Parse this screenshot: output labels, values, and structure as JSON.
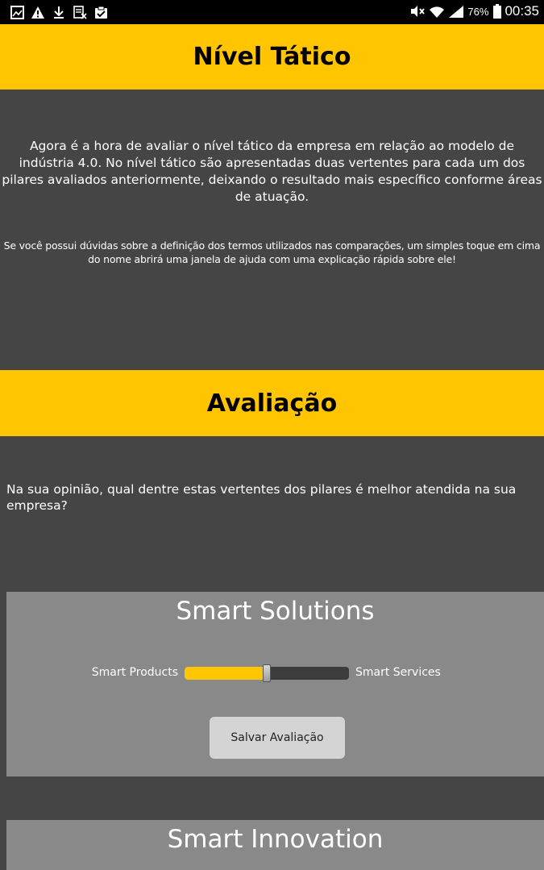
{
  "status_bar": {
    "left_icons": [
      "gallery-icon",
      "warning-icon",
      "download-icon",
      "screenshot-icon",
      "clipboard-check-icon"
    ],
    "battery_percent": "76%",
    "time": "00:35"
  },
  "header": {
    "title": "Nível Tático"
  },
  "intro": {
    "text": "Agora é a hora de avaliar o nível tático da empresa em relação ao modelo de indústria 4.0. No nível tático são apresentadas duas vertentes para cada um dos pilares avaliados anteriormente, deixando o resultado mais específico conforme áreas de atuação.",
    "help": "Se você possui dúvidas sobre a definição dos termos utilizados nas comparações, um simples toque em cima do nome abrirá uma janela de ajuda com uma explicação rápida sobre ele!"
  },
  "evaluation": {
    "title": "Avaliação",
    "question": "Na sua opinião, qual dentre estas vertentes dos pilares é melhor atendida na sua empresa?"
  },
  "cards": [
    {
      "title": "Smart Solutions",
      "left_label": "Smart Products",
      "right_label": "Smart Services",
      "slider_value": 0.5,
      "button_label": "Salvar Avaliação"
    },
    {
      "title": "Smart Innovation"
    }
  ],
  "colors": {
    "accent": "#ffc500",
    "background": "#454545",
    "card": "#898989"
  }
}
